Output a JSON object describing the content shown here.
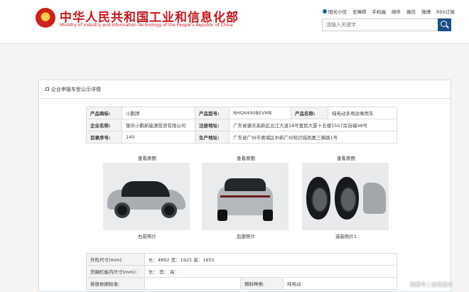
{
  "header": {
    "title_cn": "中华人民共和国工业和信息化部",
    "title_en": "Ministry of Industry and Information Technology of the People's Republic of China",
    "links": [
      "阳光小信",
      "无障碍",
      "手机端",
      "邮件",
      "微信",
      "微博",
      "RSS订阅"
    ],
    "search_placeholder": "请输入关键字"
  },
  "panel": {
    "title": "企业申报车型公示详情"
  },
  "info": {
    "brand_label": "产品商标:",
    "brand_value": "小鹏牌",
    "model_label": "产品型号:",
    "model_value": "NHQ6490BEVMB",
    "name_label": "产品名称:",
    "name_value": "纯电动多用途乘用车",
    "company_label": "企业名称:",
    "company_value": "肇庆小鹏新能源投资有限公司",
    "address_label": "注册地址:",
    "address_value": "广东省肇庆高新区北江大道18号富民大厦十五楼1507房自编48号",
    "seq_label": "目录序号:",
    "seq_value": "140",
    "plant_label": "生产地址:",
    "plant_value": "广东省广州市黄埔区中新广州知识城凤凰三横路1号"
  },
  "photos": [
    {
      "head": "查看原图",
      "caption": "右前照片"
    },
    {
      "head": "查看原图",
      "caption": "后部照片"
    },
    {
      "head": "查看原图",
      "caption": "选装照片1"
    }
  ],
  "spec": {
    "size_label": "外形尺寸(mm):",
    "size_value": "长：4892 宽：1925 高：1655",
    "cargo_label": "货厢栏板内尺寸(mm):",
    "cargo_value": "长：  宽：  高：",
    "emission_label": "排放依据标准:",
    "emission_value": "",
    "fuel_label": "燃料种类:",
    "fuel_value": "纯电动"
  },
  "watermark": "网易号 | 波讯说车"
}
